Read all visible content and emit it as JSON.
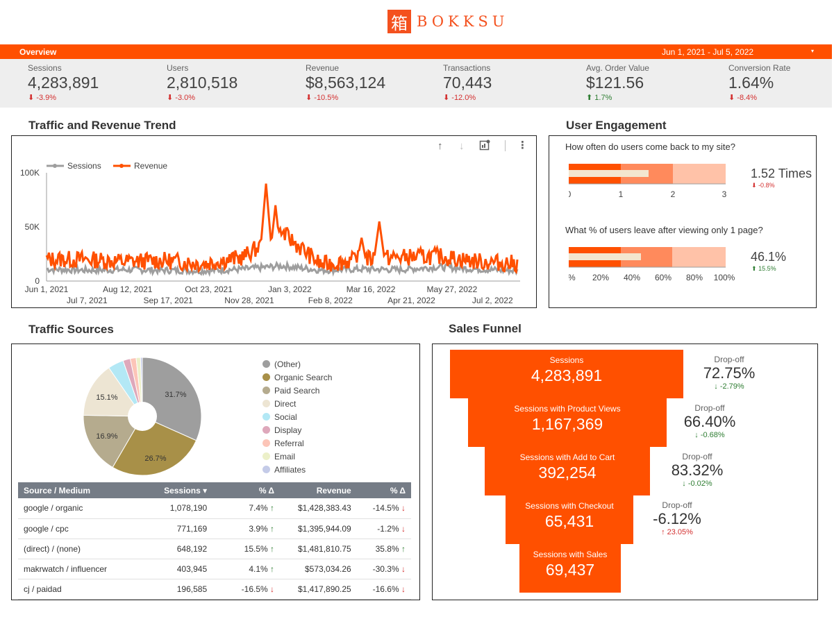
{
  "brand": {
    "logo_glyph": "箱",
    "name": "BOKKSU",
    "color": "#f4511e"
  },
  "overview": {
    "title": "Overview",
    "date_range": "Jun 1, 2021 - Jul 5, 2022",
    "caret": "▾"
  },
  "kpis": [
    {
      "label": "Sessions",
      "value": "4,283,891",
      "delta": "-3.9%",
      "dir": "neg"
    },
    {
      "label": "Users",
      "value": "2,810,518",
      "delta": "-3.0%",
      "dir": "neg"
    },
    {
      "label": "Revenue",
      "value": "$8,563,124",
      "delta": "-10.5%",
      "dir": "neg"
    },
    {
      "label": "Transactions",
      "value": "70,443",
      "delta": "-12.0%",
      "dir": "neg"
    },
    {
      "label": "Avg. Order Value",
      "value": "$121.56",
      "delta": "1.7%",
      "dir": "pos"
    },
    {
      "label": "Conversion Rate",
      "value": "1.64%",
      "delta": "-8.4%",
      "dir": "neg"
    }
  ],
  "trend": {
    "title": "Traffic and Revenue Trend",
    "tool_icons": [
      "arrow-up-icon",
      "arrow-down-icon",
      "drill-chart-icon",
      "more-vert-icon"
    ],
    "chart_data": {
      "type": "line",
      "legend": [
        "Sessions",
        "Revenue"
      ],
      "legend_position": "top-left",
      "ylim": [
        0,
        100000
      ],
      "y_ticks": [
        "0",
        "50K",
        "100K"
      ],
      "x_ticks_top": [
        "Jun 1, 2021",
        "Aug 12, 2021",
        "Oct 23, 2021",
        "Jan 3, 2022",
        "Mar 16, 2022",
        "May 27, 2022"
      ],
      "x_ticks_bottom": [
        "Jul 7, 2021",
        "Sep 17, 2021",
        "Nov 28, 2021",
        "Feb 8, 2022",
        "Apr 21, 2022",
        "Jul 2, 2022"
      ],
      "colors": {
        "Sessions": "#9e9e9e",
        "Revenue": "#ff5000"
      },
      "series_monthly": {
        "months": [
          "Jun 2021",
          "Jul 2021",
          "Aug 2021",
          "Sep 2021",
          "Oct 2021",
          "Nov 2021",
          "Dec 2021",
          "Jan 2022",
          "Feb 2022",
          "Mar 2022",
          "Apr 2022",
          "May 2022",
          "Jun 2022"
        ],
        "Sessions": [
          11000,
          10000,
          10500,
          10000,
          9500,
          11000,
          14000,
          10000,
          11000,
          10500,
          13000,
          11000,
          9500
        ],
        "Revenue": [
          20000,
          20000,
          18000,
          19000,
          16000,
          22000,
          45000,
          15000,
          20000,
          22000,
          23000,
          18000,
          16000
        ]
      },
      "peaks": {
        "Revenue_max": 90000,
        "Revenue_mar_2022": 55000
      }
    }
  },
  "engagement": {
    "title": "User Engagement",
    "q1": "How often do users come back to my site?",
    "q1_value": "1.52 Times",
    "q1_delta": "-0.8%",
    "q1_axis": [
      "0",
      "1",
      "2",
      "3"
    ],
    "q1_bullet": {
      "value": 1.52,
      "bands": [
        1,
        2,
        3
      ],
      "max": 3
    },
    "q2": "What % of users leave after viewing only 1 page?",
    "q2_value": "46.1%",
    "q2_delta": "15.5%",
    "q2_axis": [
      "0%",
      "20%",
      "40%",
      "60%",
      "80%",
      "100%"
    ],
    "q2_bullet": {
      "value": 46.1,
      "bands": [
        33,
        66,
        100
      ],
      "max": 100
    }
  },
  "sources": {
    "title": "Traffic Sources",
    "chart_data": {
      "type": "pie",
      "labels": [
        "(Other)",
        "Organic Search",
        "Paid Search",
        "Direct",
        "Social",
        "Display",
        "Referral",
        "Email",
        "Affiliates"
      ],
      "values": [
        31.7,
        26.7,
        16.9,
        15.1,
        4.3,
        2.0,
        1.6,
        1.2,
        0.5
      ],
      "colors": [
        "#9e9e9e",
        "#a89048",
        "#b5ab8e",
        "#ede5d3",
        "#b3e8f5",
        "#dea8bb",
        "#fcc5b8",
        "#ecf0c9",
        "#c4cbe8"
      ],
      "value_labels": [
        "31.7%",
        "26.7%",
        "16.9%",
        "15.1%"
      ]
    },
    "table": {
      "headers": [
        "Source / Medium",
        "Sessions ▾",
        "% Δ",
        "Revenue",
        "% Δ"
      ],
      "rows": [
        [
          "google / organic",
          "1,078,190",
          "7.4%",
          "↑",
          "$1,428,383.43",
          "-14.5%",
          "↓"
        ],
        [
          "google / cpc",
          "771,169",
          "3.9%",
          "↑",
          "$1,395,944.09",
          "-1.2%",
          "↓"
        ],
        [
          "(direct) / (none)",
          "648,192",
          "15.5%",
          "↑",
          "$1,481,810.75",
          "35.8%",
          "↑"
        ],
        [
          "makrwatch / influencer",
          "403,945",
          "4.1%",
          "↑",
          "$573,034.26",
          "-30.3%",
          "↓"
        ],
        [
          "cj / paidad",
          "196,585",
          "-16.5%",
          "↓",
          "$1,417,890.25",
          "-16.6%",
          "↓"
        ]
      ]
    }
  },
  "funnel": {
    "title": "Sales Funnel",
    "steps": [
      {
        "label": "Sessions",
        "value": "4,283,891"
      },
      {
        "label": "Sessions with Product Views",
        "value": "1,167,369"
      },
      {
        "label": "Sessions with Add to Cart",
        "value": "392,254"
      },
      {
        "label": "Sessions with Checkout",
        "value": "65,431"
      },
      {
        "label": "Sessions with Sales",
        "value": "69,437"
      }
    ],
    "dropoffs": [
      {
        "label": "Drop-off",
        "value": "72.75%",
        "delta": "-2.79%",
        "dir": "pos",
        "arrow": "↓"
      },
      {
        "label": "Drop-off",
        "value": "66.40%",
        "delta": "-0.68%",
        "dir": "pos",
        "arrow": "↓"
      },
      {
        "label": "Drop-off",
        "value": "83.32%",
        "delta": "-0.02%",
        "dir": "pos",
        "arrow": "↓"
      },
      {
        "label": "Drop-off",
        "value": "-6.12%",
        "delta": "23.05%",
        "dir": "neg",
        "arrow": "↑"
      }
    ]
  }
}
